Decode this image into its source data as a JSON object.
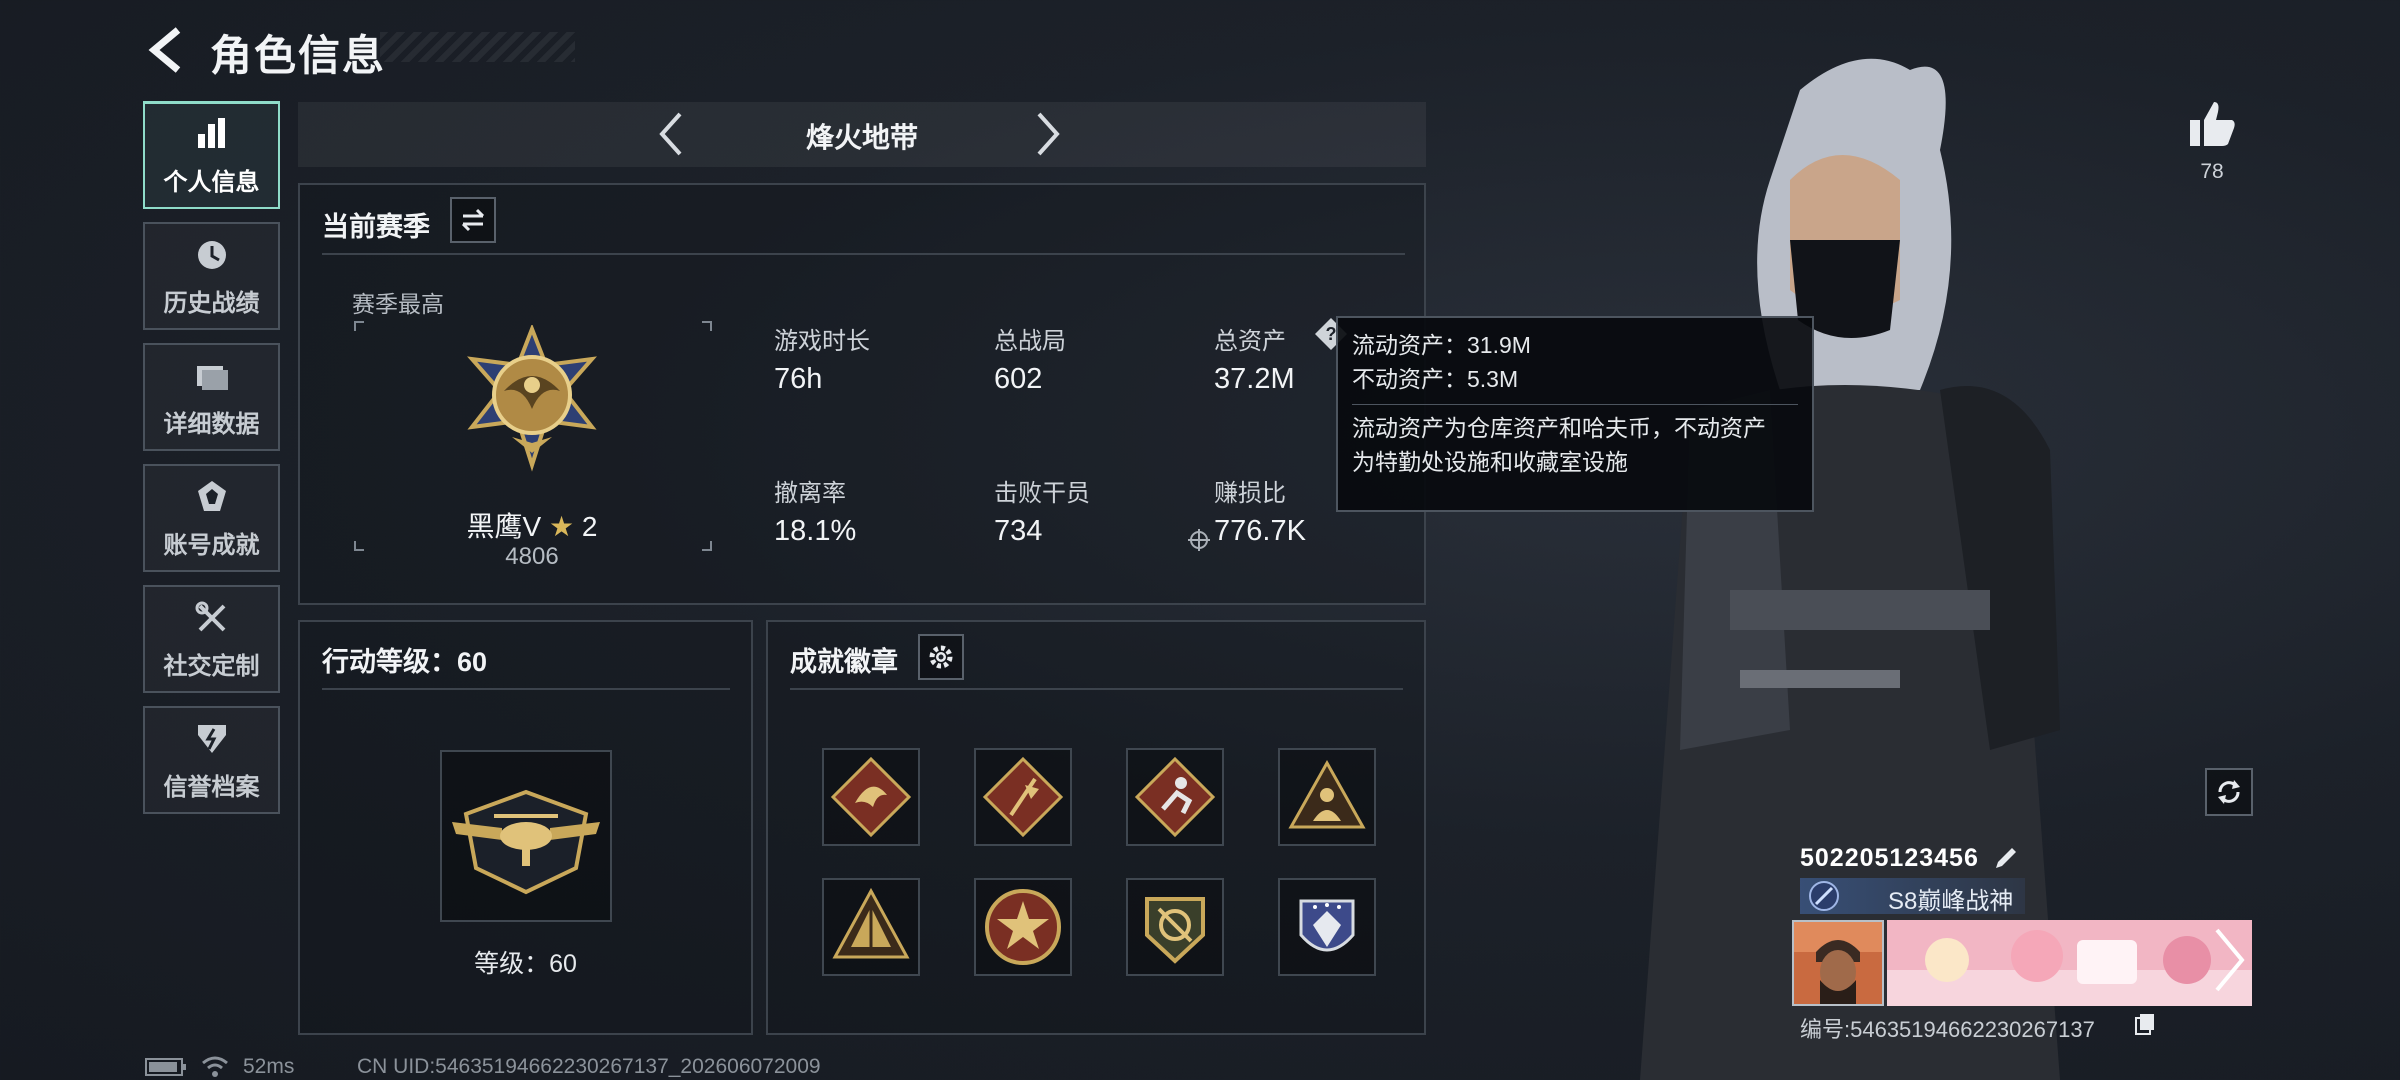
{
  "header": {
    "title": "角色信息"
  },
  "sidebar": {
    "items": [
      {
        "label": "个人信息",
        "icon": "bar-chart-icon",
        "active": true
      },
      {
        "label": "历史战绩",
        "icon": "clock-icon",
        "active": false
      },
      {
        "label": "详细数据",
        "icon": "folder-icon",
        "active": false
      },
      {
        "label": "账号成就",
        "icon": "achievement-icon",
        "active": false
      },
      {
        "label": "社交定制",
        "icon": "wrench-screwdriver-icon",
        "active": false
      },
      {
        "label": "信誉档案",
        "icon": "shield-icon",
        "active": false
      }
    ]
  },
  "mode": {
    "title": "烽火地带"
  },
  "season": {
    "title": "当前赛季",
    "best_label": "赛季最高",
    "rank_name": "黑鹰V",
    "rank_stars": "2",
    "rank_score": "4806",
    "stats": [
      {
        "label": "游戏时长",
        "value": "76h"
      },
      {
        "label": "总战局",
        "value": "602"
      },
      {
        "label": "总资产",
        "value": "37.2M",
        "has_help": true
      },
      {
        "label": "撤离率",
        "value": "18.1%"
      },
      {
        "label": "击败干员",
        "value": "734"
      },
      {
        "label": "赚损比",
        "value": "776.7K"
      }
    ]
  },
  "tooltip": {
    "liquid": "流动资产：31.9M",
    "fixed": "不动资产：5.3M",
    "desc_line1": "流动资产为仓库资产和哈夫币，不动资产",
    "desc_line2": "为特勤处设施和收藏室设施"
  },
  "action": {
    "title": "行动等级：60",
    "level_label": "等级：60"
  },
  "badges": {
    "title": "成就徽章",
    "items": [
      "dragon-badge",
      "flag-badge",
      "runner-badge",
      "soldier-badge",
      "pyramid-badge",
      "star-badge",
      "crest-badge",
      "helmet-badge"
    ]
  },
  "player": {
    "likes": "78",
    "name": "502205123456",
    "rank_title": "S8巅峰战神",
    "id_text": "编号:5463519466223026713​7"
  },
  "footer": {
    "ping": "52ms",
    "uid": "CN UID:5463519466223026713​7_202606072009"
  },
  "colors": {
    "accent": "#8fdcc9",
    "gold": "#c9a85a",
    "panel_border": "#3c434c"
  }
}
